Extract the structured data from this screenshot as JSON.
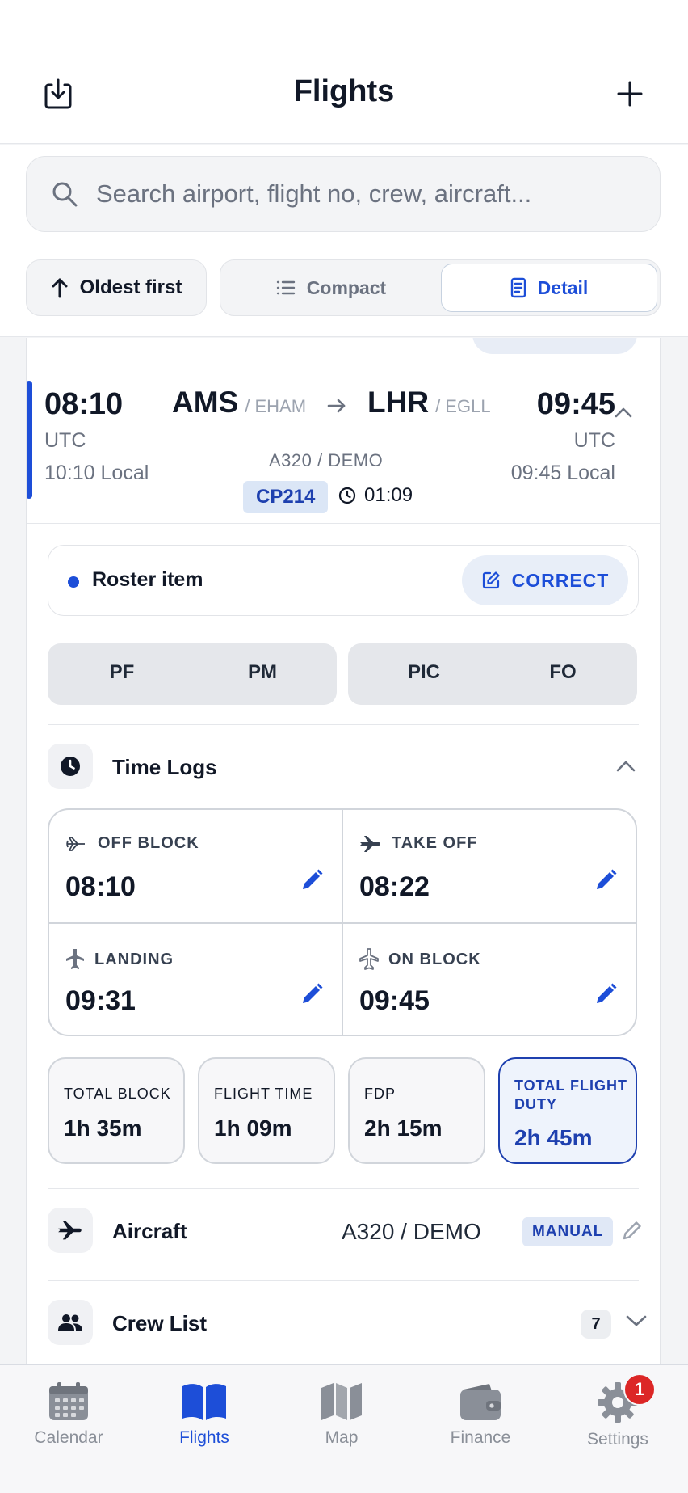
{
  "header": {
    "title": "Flights",
    "download_icon": "download-icon",
    "add_icon": "plus-icon"
  },
  "search": {
    "placeholder": "Search airport, flight no, crew, aircraft..."
  },
  "sort": {
    "label": "Oldest first"
  },
  "view_toggle": {
    "compact_label": "Compact",
    "detail_label": "Detail",
    "selected": "Detail"
  },
  "flight": {
    "dep_time": "08:10",
    "dep_tz": "UTC",
    "dep_local": "10:10 Local",
    "from_code": "AMS",
    "from_icao": "/ EHAM",
    "to_code": "LHR",
    "to_icao": "/ EGLL",
    "aircraft": "A320 / DEMO",
    "flight_no": "CP214",
    "duration": "01:09",
    "arr_time": "09:45",
    "arr_tz": "UTC",
    "arr_local": "09:45 Local"
  },
  "roster": {
    "label": "Roster item",
    "correct_label": "CORRECT"
  },
  "roles": {
    "group1": [
      "PF",
      "PM"
    ],
    "group2": [
      "PIC",
      "FO"
    ]
  },
  "time_logs": {
    "title": "Time Logs",
    "off_block": {
      "label": "OFF BLOCK",
      "value": "08:10"
    },
    "take_off": {
      "label": "TAKE OFF",
      "value": "08:22"
    },
    "landing": {
      "label": "LANDING",
      "value": "09:31"
    },
    "on_block": {
      "label": "ON BLOCK",
      "value": "09:45"
    }
  },
  "totals": {
    "total_block": {
      "label": "TOTAL BLOCK",
      "value": "1h 35m"
    },
    "flight_time": {
      "label": "FLIGHT TIME",
      "value": "1h 09m"
    },
    "fdp": {
      "label": "FDP",
      "value": "2h 15m"
    },
    "total_flight_duty": {
      "label": "TOTAL FLIGHT DUTY",
      "value": "2h 45m"
    }
  },
  "aircraft_row": {
    "title": "Aircraft",
    "value": "A320 / DEMO",
    "badge": "MANUAL"
  },
  "crew_row": {
    "title": "Crew List",
    "count": "7"
  },
  "tabbar": {
    "tabs": [
      {
        "label": "Calendar",
        "icon": "calendar-icon"
      },
      {
        "label": "Flights",
        "icon": "book-icon"
      },
      {
        "label": "Map",
        "icon": "map-icon"
      },
      {
        "label": "Finance",
        "icon": "wallet-icon"
      },
      {
        "label": "Settings",
        "icon": "gear-icon"
      }
    ],
    "active": "Flights",
    "settings_badge": "1"
  },
  "colors": {
    "accent": "#1d4ed8",
    "badge_red": "#dc2626"
  }
}
